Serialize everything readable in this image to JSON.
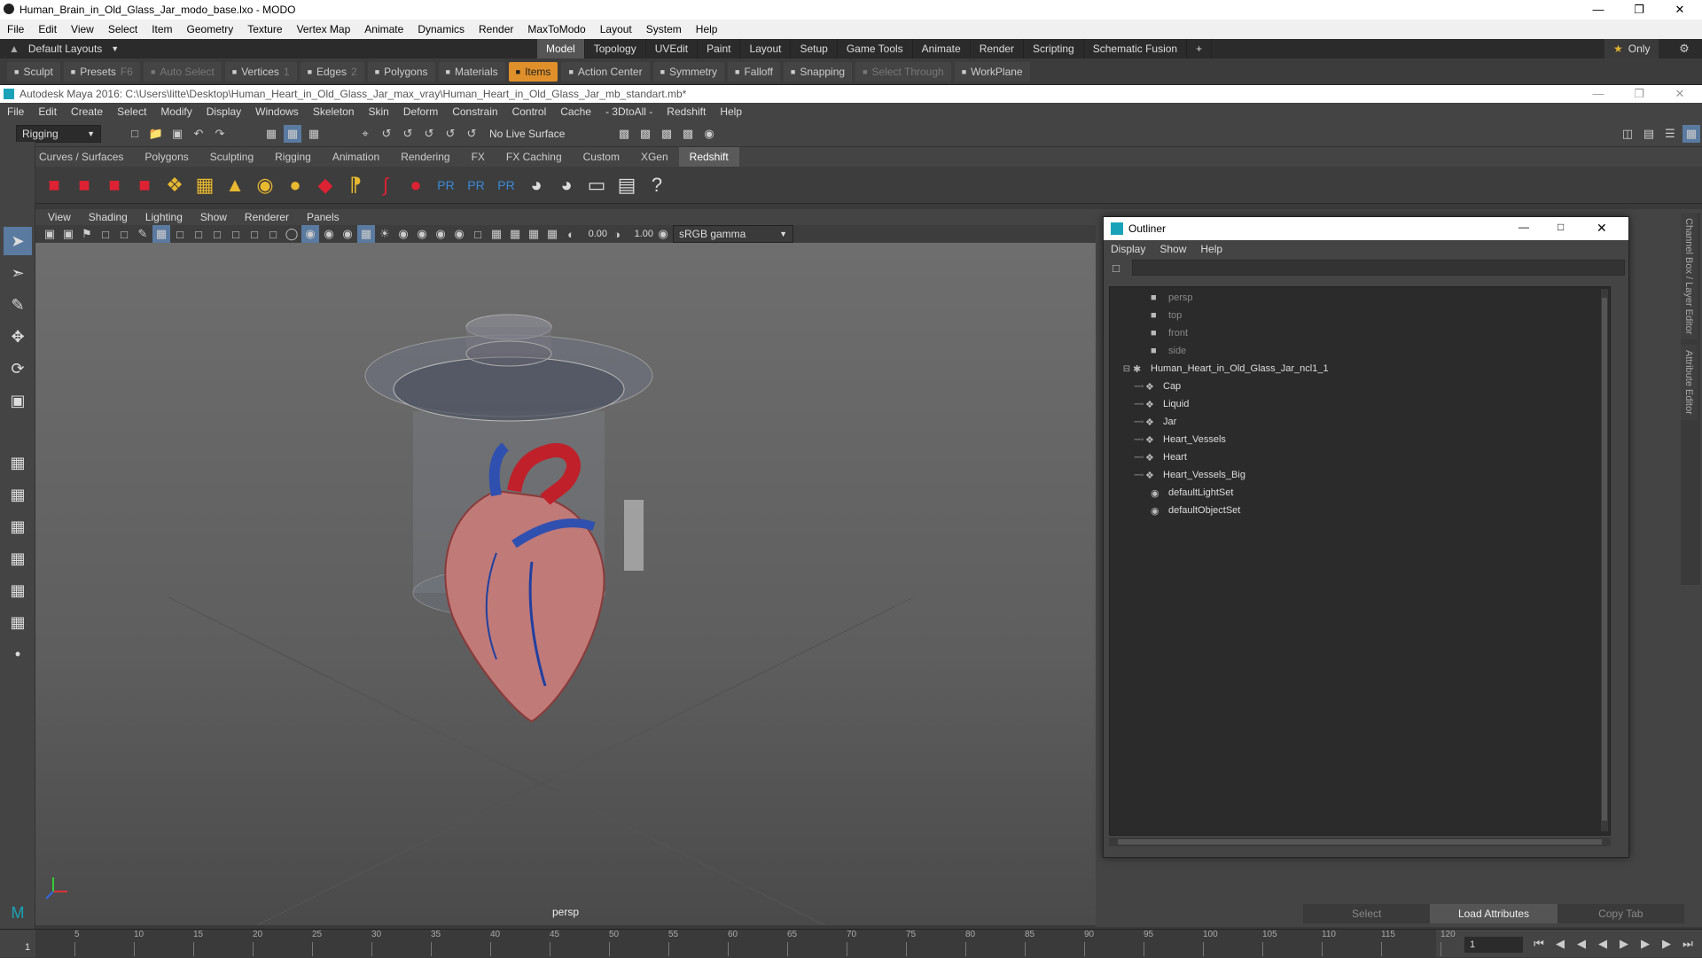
{
  "modo": {
    "title": "Human_Brain_in_Old_Glass_Jar_modo_base.lxo - MODO",
    "menu": [
      "File",
      "Edit",
      "View",
      "Select",
      "Item",
      "Geometry",
      "Texture",
      "Vertex Map",
      "Animate",
      "Dynamics",
      "Render",
      "MaxToModo",
      "Layout",
      "System",
      "Help"
    ],
    "layout_dropdown": "Default Layouts",
    "tabs": [
      "Model",
      "Topology",
      "UVEdit",
      "Paint",
      "Layout",
      "Setup",
      "Game Tools",
      "Animate",
      "Render",
      "Scripting",
      "Schematic Fusion"
    ],
    "only_label": "Only",
    "tools": [
      {
        "label": "Sculpt"
      },
      {
        "label": "Presets",
        "key": "F6"
      },
      {
        "label": "Auto Select",
        "dim": true
      },
      {
        "label": "Vertices",
        "key": "1"
      },
      {
        "label": "Edges",
        "key": "2"
      },
      {
        "label": "Polygons"
      },
      {
        "label": "Materials"
      },
      {
        "label": "Items",
        "active": true
      },
      {
        "label": "Action Center"
      },
      {
        "label": "Symmetry"
      },
      {
        "label": "Falloff"
      },
      {
        "label": "Snapping"
      },
      {
        "label": "Select Through",
        "dim": true
      },
      {
        "label": "WorkPlane"
      }
    ]
  },
  "maya": {
    "title": "Autodesk Maya 2016: C:\\Users\\litte\\Desktop\\Human_Heart_in_Old_Glass_Jar_max_vray\\Human_Heart_in_Old_Glass_Jar_mb_standart.mb*",
    "menu": [
      "File",
      "Edit",
      "Create",
      "Select",
      "Modify",
      "Display",
      "Windows",
      "Skeleton",
      "Skin",
      "Deform",
      "Constrain",
      "Control",
      "Cache",
      "- 3DtoAll -",
      "Redshift",
      "Help"
    ],
    "mode_dropdown": "Rigging",
    "live_surface": "No Live Surface",
    "shelf_tabs": [
      "Curves / Surfaces",
      "Polygons",
      "Sculpting",
      "Rigging",
      "Animation",
      "Rendering",
      "FX",
      "FX Caching",
      "Custom",
      "XGen",
      "Redshift"
    ],
    "shelf_active": "Redshift",
    "viewport_menu": [
      "View",
      "Shading",
      "Lighting",
      "Show",
      "Renderer",
      "Panels"
    ],
    "exposure": "0.00",
    "gamma": "1.00",
    "color_space": "sRGB gamma",
    "camera_label": "persp",
    "right_buttons": [
      "Select",
      "Load Attributes",
      "Copy Tab"
    ],
    "side_tabs": [
      "Channel Box / Layer Editor",
      "Attribute Editor"
    ],
    "timeline": {
      "ticks": [
        "5",
        "10",
        "15",
        "20",
        "25",
        "30",
        "35",
        "40",
        "45",
        "50",
        "55",
        "60",
        "65",
        "70",
        "75",
        "80",
        "85",
        "90",
        "95",
        "100",
        "105",
        "110",
        "115",
        "120"
      ],
      "start": "1",
      "current": "1"
    }
  },
  "outliner": {
    "title": "Outliner",
    "menu": [
      "Display",
      "Show",
      "Help"
    ],
    "cameras": [
      "persp",
      "top",
      "front",
      "side"
    ],
    "group": "Human_Heart_in_Old_Glass_Jar_ncl1_1",
    "children": [
      "Cap",
      "Liquid",
      "Jar",
      "Heart_Vessels",
      "Heart",
      "Heart_Vessels_Big"
    ],
    "sets": [
      "defaultLightSet",
      "defaultObjectSet"
    ]
  },
  "colors": {
    "accent": "#e0902a",
    "maya_bg": "#444444"
  }
}
